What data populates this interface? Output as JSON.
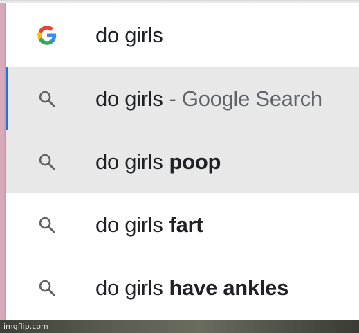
{
  "omnibox": {
    "query": "do girls",
    "google_icon": "google-g-icon"
  },
  "suggestions": [
    {
      "base": "do girls",
      "bold": "",
      "suffix": "- Google Search",
      "icon": "search-icon",
      "highlighted": true,
      "focused": true
    },
    {
      "base": "do girls",
      "bold": "poop",
      "suffix": "",
      "icon": "search-icon",
      "highlighted": true,
      "focused": false
    },
    {
      "base": "do girls",
      "bold": "fart",
      "suffix": "",
      "icon": "search-icon",
      "highlighted": false,
      "focused": false
    },
    {
      "base": "do girls",
      "bold": "have ankles",
      "suffix": "",
      "icon": "search-icon",
      "highlighted": false,
      "focused": false
    }
  ],
  "watermark": "imgflip.com",
  "colors": {
    "focus_bar": "#1a73e8",
    "highlight": "#e8e8e8",
    "google_blue": "#4285f4",
    "google_red": "#ea4335",
    "google_yellow": "#fbbc05",
    "google_green": "#34a853"
  }
}
